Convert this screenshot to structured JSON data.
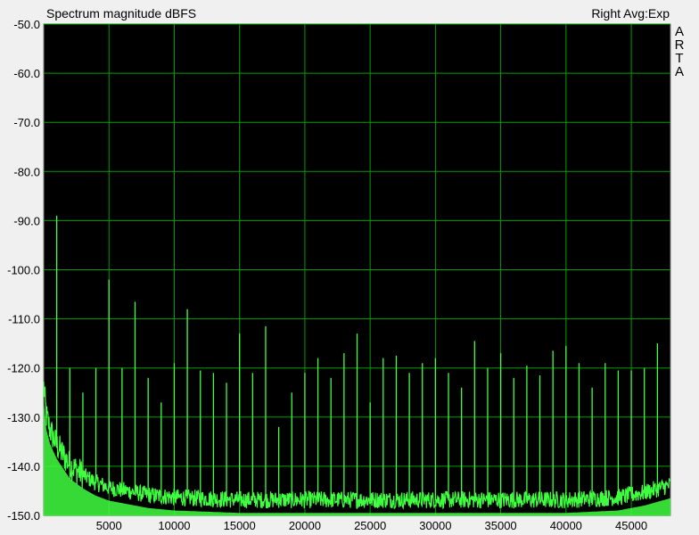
{
  "chart_data": {
    "type": "line",
    "title": "Spectrum magnitude dBFS",
    "legend": "Right Avg:Exp",
    "vendor_label": "ARTA",
    "xlim": [
      0,
      48000
    ],
    "ylim": [
      -150,
      -50
    ],
    "x_ticks": [
      5000,
      10000,
      15000,
      20000,
      25000,
      30000,
      35000,
      40000,
      45000
    ],
    "x_tick_labels": [
      "5000",
      "10000",
      "15000",
      "20000",
      "25000",
      "30000",
      "35000",
      "40000",
      "45000"
    ],
    "y_ticks": [
      -50,
      -60,
      -70,
      -80,
      -90,
      -100,
      -110,
      -120,
      -130,
      -140,
      -150
    ],
    "y_tick_labels": [
      "-50.0",
      "-60.0",
      "-70.0",
      "-80.0",
      "-90.0",
      "-100.0",
      "-110.0",
      "-120.0",
      "-130.0",
      "-140.0",
      "-150.0"
    ],
    "grid": true,
    "colors": {
      "plot_background": "#000000",
      "grid": "#00a000",
      "trace": "#40ff40",
      "page_background": "#f0f0f0"
    },
    "series": [
      {
        "name": "Right",
        "noise_floor": {
          "x": [
            0,
            200,
            500,
            1000,
            1500,
            2000,
            3000,
            4000,
            5000,
            6000,
            8000,
            10000,
            15000,
            20000,
            25000,
            30000,
            35000,
            40000,
            44000,
            46000,
            48000
          ],
          "y": [
            -124,
            -130,
            -133,
            -136,
            -138,
            -140,
            -142,
            -143.5,
            -144.5,
            -145,
            -146,
            -146.5,
            -147,
            -147,
            -147,
            -147,
            -147,
            -147,
            -146.5,
            -145.5,
            -144
          ]
        },
        "peaks": {
          "x": [
            1000,
            2000,
            3000,
            4000,
            5000,
            6000,
            7000,
            8000,
            9000,
            10000,
            11000,
            12000,
            13000,
            14000,
            15000,
            16000,
            17000,
            18000,
            19000,
            20000,
            21000,
            22000,
            23000,
            24000,
            25000,
            26000,
            27000,
            28000,
            29000,
            30000,
            31000,
            32000,
            33000,
            34000,
            35000,
            36000,
            37000,
            38000,
            39000,
            40000,
            41000,
            42000,
            43000,
            44000,
            45000,
            46000,
            47000
          ],
          "y": [
            -89,
            -120,
            -125,
            -120,
            -102,
            -120,
            -106.5,
            -122,
            -127,
            -119,
            -108,
            -120.5,
            -121,
            -123,
            -113,
            -121,
            -111.5,
            -132,
            -125,
            -121,
            -118,
            -122,
            -117,
            -113,
            -127,
            -118,
            -117.5,
            -121,
            -119,
            -118,
            -121,
            -124,
            -114.5,
            -120,
            -117,
            -122,
            -119.5,
            -121.5,
            -116.5,
            -115.5,
            -119,
            -124,
            -119,
            -120.5,
            -120.5,
            -120,
            -115
          ]
        }
      }
    ]
  }
}
